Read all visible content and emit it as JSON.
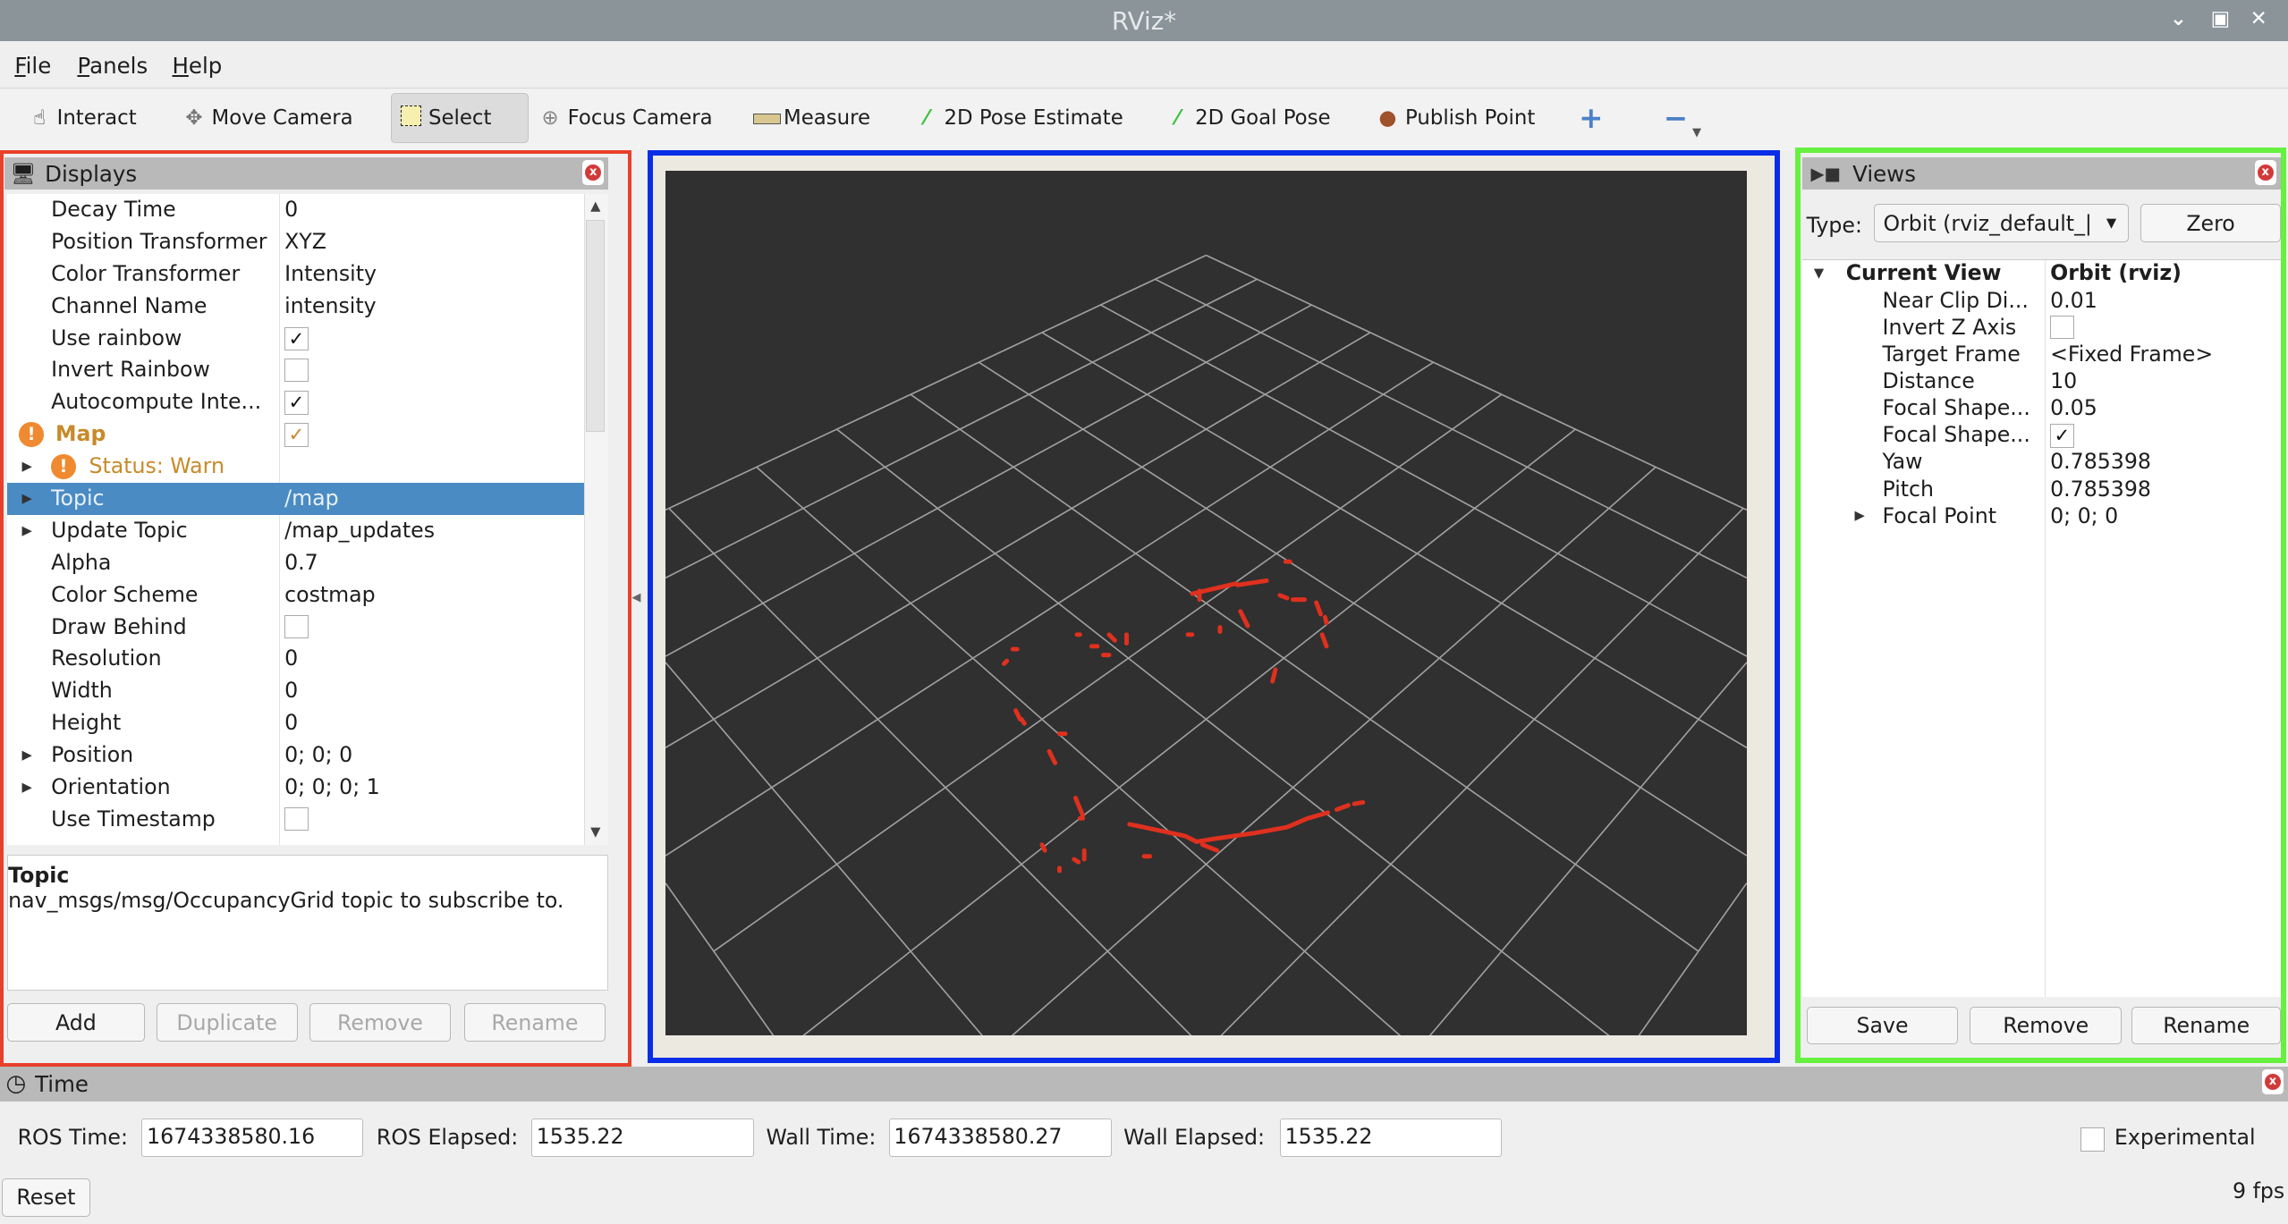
{
  "window": {
    "title": "RViz*",
    "controls": [
      "minimize",
      "maximize",
      "close"
    ]
  },
  "menu": [
    {
      "label": "File",
      "mnemonic": "F",
      "rest": "ile"
    },
    {
      "label": "Panels",
      "mnemonic": "P",
      "rest": "anels"
    },
    {
      "label": "Help",
      "mnemonic": "H",
      "rest": "elp"
    }
  ],
  "toolbar": {
    "tools": [
      {
        "label": "Interact",
        "icon": "hand-icon"
      },
      {
        "label": "Move Camera",
        "icon": "move-camera-icon"
      },
      {
        "label": "Select",
        "icon": "select-icon",
        "active": true
      },
      {
        "label": "Focus Camera",
        "icon": "focus-camera-icon"
      },
      {
        "label": "Measure",
        "icon": "ruler-icon"
      },
      {
        "label": "2D Pose Estimate",
        "icon": "green-arrow-icon"
      },
      {
        "label": "2D Goal Pose",
        "icon": "green-arrow-icon"
      },
      {
        "label": "Publish Point",
        "icon": "map-pin-icon"
      }
    ],
    "add_tool": "+",
    "remove_tool": "−"
  },
  "displays": {
    "title": "Displays",
    "rows": [
      {
        "key": "Decay Time",
        "value": "0"
      },
      {
        "key": "Position Transformer",
        "value": "XYZ"
      },
      {
        "key": "Color Transformer",
        "value": "Intensity"
      },
      {
        "key": "Channel Name",
        "value": "intensity"
      },
      {
        "key": "Use rainbow",
        "checked": true
      },
      {
        "key": "Invert Rainbow",
        "checked": false
      },
      {
        "key": "Autocompute Inte...",
        "checked": true
      },
      {
        "key": "Map",
        "checked": true,
        "warn": true
      },
      {
        "key": "Status: Warn",
        "warn": true,
        "expandable": true
      },
      {
        "key": "Topic",
        "value": "/map",
        "expandable": true,
        "selected": true
      },
      {
        "key": "Update Topic",
        "value": "/map_updates",
        "expandable": true
      },
      {
        "key": "Alpha",
        "value": "0.7"
      },
      {
        "key": "Color Scheme",
        "value": "costmap"
      },
      {
        "key": "Draw Behind",
        "checked": false
      },
      {
        "key": "Resolution",
        "value": "0"
      },
      {
        "key": "Width",
        "value": "0"
      },
      {
        "key": "Height",
        "value": "0"
      },
      {
        "key": "Position",
        "value": "0; 0; 0",
        "expandable": true
      },
      {
        "key": "Orientation",
        "value": "0; 0; 0; 1",
        "expandable": true
      },
      {
        "key": "Use Timestamp",
        "checked": false
      }
    ],
    "description": {
      "title": "Topic",
      "text": "nav_msgs/msg/OccupancyGrid topic to subscribe to."
    },
    "buttons": {
      "add": "Add",
      "duplicate": "Duplicate",
      "remove": "Remove",
      "rename": "Rename"
    }
  },
  "views": {
    "title": "Views",
    "type_label": "Type:",
    "type_value": "Orbit (rviz_default_|",
    "zero": "Zero",
    "current_view": {
      "key": "Current View",
      "value": "Orbit (rviz)"
    },
    "rows": [
      {
        "key": "Near Clip Di...",
        "value": "0.01"
      },
      {
        "key": "Invert Z Axis",
        "checked": false
      },
      {
        "key": "Target Frame",
        "value": "<Fixed Frame>"
      },
      {
        "key": "Distance",
        "value": "10"
      },
      {
        "key": "Focal Shape...",
        "value": "0.05"
      },
      {
        "key": "Focal Shape...",
        "checked": true
      },
      {
        "key": "Yaw",
        "value": "0.785398"
      },
      {
        "key": "Pitch",
        "value": "0.785398"
      },
      {
        "key": "Focal Point",
        "value": "0; 0; 0",
        "expandable": true
      }
    ],
    "buttons": {
      "save": "Save",
      "remove": "Remove",
      "rename": "Rename"
    }
  },
  "time": {
    "title": "Time",
    "ros_time_label": "ROS Time:",
    "ros_time": "1674338580.16",
    "ros_elapsed_label": "ROS Elapsed:",
    "ros_elapsed": "1535.22",
    "wall_time_label": "Wall Time:",
    "wall_time": "1674338580.27",
    "wall_elapsed_label": "Wall Elapsed:",
    "wall_elapsed": "1535.22",
    "experimental": "Experimental",
    "experimental_checked": false,
    "reset": "Reset",
    "fps": "9 fps"
  },
  "colors": {
    "displays_highlight": "#e8402a",
    "viewport_highlight": "#0a2de8",
    "views_highlight": "#66f040",
    "selection": "#4a8bc4",
    "warn": "#c88a2a",
    "scan_points": "#e0301e",
    "viewport_bg": "#303030",
    "grid": "#a0a0a0"
  }
}
